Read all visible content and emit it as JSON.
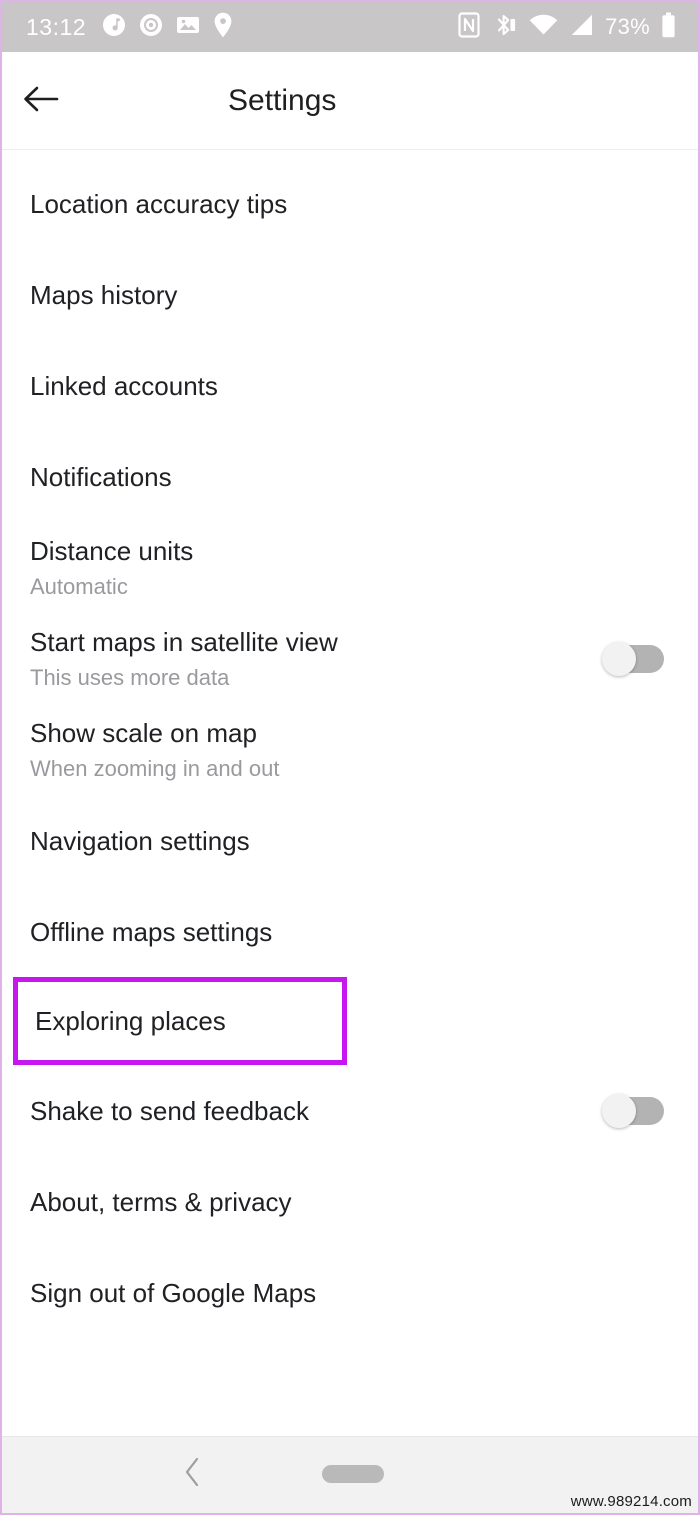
{
  "status_bar": {
    "time": "13:12",
    "battery_percent": "73%",
    "left_icons": [
      "music-note-icon",
      "record-disc-icon",
      "photo-icon",
      "location-pin-icon"
    ],
    "right_icons": [
      "nfc-icon",
      "bluetooth-icon",
      "wifi-icon",
      "cellular-signal-icon",
      "battery-icon"
    ],
    "background_color": "#c9c6c8",
    "text_color": "#ffffff"
  },
  "app_bar": {
    "back_icon": "arrow-left-icon",
    "title": "Settings"
  },
  "settings": {
    "rows": [
      {
        "title": "Location accuracy tips",
        "subtitle": null,
        "toggle": null,
        "highlighted": false
      },
      {
        "title": "Maps history",
        "subtitle": null,
        "toggle": null,
        "highlighted": false
      },
      {
        "title": "Linked accounts",
        "subtitle": null,
        "toggle": null,
        "highlighted": false
      },
      {
        "title": "Notifications",
        "subtitle": null,
        "toggle": null,
        "highlighted": false
      },
      {
        "title": "Distance units",
        "subtitle": "Automatic",
        "toggle": null,
        "highlighted": false
      },
      {
        "title": "Start maps in satellite view",
        "subtitle": "This uses more data",
        "toggle": "off",
        "highlighted": false
      },
      {
        "title": "Show scale on map",
        "subtitle": "When zooming in and out",
        "toggle": null,
        "highlighted": false
      },
      {
        "title": "Navigation settings",
        "subtitle": null,
        "toggle": null,
        "highlighted": false
      },
      {
        "title": "Offline maps settings",
        "subtitle": null,
        "toggle": null,
        "highlighted": false
      },
      {
        "title": "Exploring places",
        "subtitle": null,
        "toggle": null,
        "highlighted": true
      },
      {
        "title": "Shake to send feedback",
        "subtitle": null,
        "toggle": "off",
        "highlighted": false
      },
      {
        "title": "About, terms & privacy",
        "subtitle": null,
        "toggle": null,
        "highlighted": false
      },
      {
        "title": "Sign out of Google Maps",
        "subtitle": null,
        "toggle": null,
        "highlighted": false
      }
    ]
  },
  "highlight": {
    "color": "#c617f0"
  },
  "nav_bar": {
    "back_icon": "chevron-left-icon",
    "home_pill": "home-pill-handle"
  },
  "watermark": {
    "text": "www.989214.com"
  }
}
